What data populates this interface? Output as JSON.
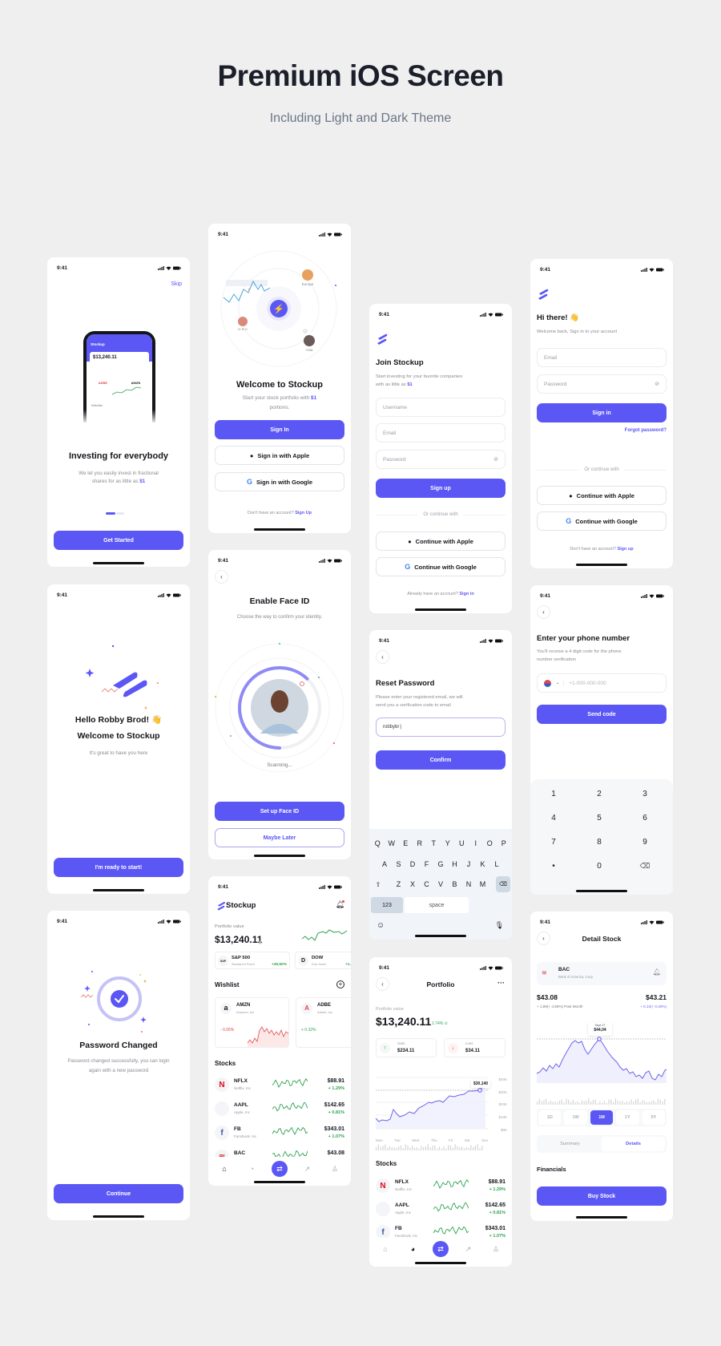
{
  "header": {
    "title": "Premium iOS Screen",
    "subtitle": "Including Light and Dark Theme"
  },
  "status": {
    "time": "9:41"
  },
  "colors": {
    "accent": "#5b57f5",
    "positive": "#2ea24f",
    "negative": "#e24848",
    "background": "#efefef"
  },
  "onboarding": {
    "skip": "Skip",
    "mockup": {
      "app": "Stockup",
      "value": "$13,240.11",
      "ticker1": "ADBE",
      "ticker2": "AMZN",
      "wishlist": "Wishlist"
    },
    "title": "Investing for everybody",
    "subtitle": "We let you easily invest in fractional shares for as little as",
    "highlight": "$1",
    "page_index": 1,
    "page_count": 2,
    "cta": "Get Started"
  },
  "welcome": {
    "avatars": [
      "Europe",
      "U.S.A",
      "Asia"
    ],
    "title": "Welcome to Stockup",
    "subtitle": "Start your stock portfolio with",
    "highlight": "$1",
    "subtitle_end": "portions.",
    "sign_in": "Sign In",
    "apple": "Sign in with Apple",
    "google": "Sign in with Google",
    "footer": "Don't have an account?",
    "footer_link": "Sign Up"
  },
  "join": {
    "title": "Join Stockup",
    "subtitle": "Start investing for your favorite companies with as little as",
    "highlight": "$1",
    "username_placeholder": "Username",
    "email_placeholder": "Email",
    "password_placeholder": "Password",
    "submit": "Sign up",
    "divider": "Or continue with",
    "apple": "Continue with Apple",
    "google": "Continue with Google",
    "footer": "Already have an account?",
    "footer_link": "Sign in"
  },
  "signin": {
    "title": "Hi there! 👋",
    "subtitle": "Welcome back, Sign in to your account",
    "email_placeholder": "Email",
    "password_placeholder": "Password",
    "submit": "Sign in",
    "forgot": "Forgot password?",
    "divider": "Or continue with",
    "apple": "Continue with Apple",
    "google": "Continue with Google",
    "footer": "Don't have an account?",
    "footer_link": "Sign up"
  },
  "hello": {
    "title": "Hello Robby Brod! 👋",
    "title2": "Welcome to Stockup",
    "subtitle": "It's great to have you here",
    "cta": "I'm ready to start!"
  },
  "faceid": {
    "title": "Enable Face ID",
    "subtitle": "Choose the way to confirm your identity.",
    "progress": 0.62,
    "status": "Scanning...",
    "primary": "Set up Face ID",
    "secondary": "Maybe Later"
  },
  "reset": {
    "title": "Reset Password",
    "subtitle": "Please enter your registered email, we will send you a verification code to  email",
    "input_value": "robbybr",
    "submit": "Confirm",
    "keyboard": {
      "row1": [
        "Q",
        "W",
        "E",
        "R",
        "T",
        "Y",
        "U",
        "I",
        "O",
        "P"
      ],
      "row2": [
        "A",
        "S",
        "D",
        "F",
        "G",
        "H",
        "J",
        "K",
        "L"
      ],
      "row3": [
        "Z",
        "X",
        "C",
        "V",
        "B",
        "N",
        "M"
      ],
      "numbers": "123",
      "space": "space"
    }
  },
  "phone": {
    "title": "Enter your phone number",
    "subtitle": "You'll receive a 4 digit code for the phone number verification",
    "placeholder": "+1-000-000-000",
    "submit": "Send code",
    "keypad": [
      "1",
      "2",
      "3",
      "4",
      "5",
      "6",
      "7",
      "8",
      "9",
      "•",
      "0"
    ]
  },
  "home": {
    "app": "Stockup",
    "portfolio_label": "Portfolio value",
    "portfolio_value": "$13,240.11",
    "indices": [
      {
        "logo": "S&P",
        "name": "S&P 500",
        "desc": "Standard & Poor's",
        "change": "+49,50%"
      },
      {
        "logo": "D",
        "name": "DOW",
        "desc": "Dow Jones",
        "change": "+1,"
      }
    ],
    "wishlist_title": "Wishlist",
    "wishlist": [
      {
        "symbol": "AMZN",
        "name": "Amazon, Inc",
        "change": "- 0.05%"
      },
      {
        "symbol": "ADBE",
        "name": "Adobe, Inc",
        "change": "+ 0.32%"
      }
    ],
    "stocks_title": "Stocks",
    "stocks": [
      {
        "symbol": "NFLX",
        "name": "Netflix, Inc",
        "price": "$88.91",
        "change": "+ 1.29%"
      },
      {
        "symbol": "AAPL",
        "name": "Apple, Inc",
        "price": "$142.65",
        "change": "+ 0.81%"
      },
      {
        "symbol": "FB",
        "name": "Facebook, Inc",
        "price": "$343.01",
        "change": "+ 1.07%"
      },
      {
        "symbol": "BAC",
        "name": "",
        "price": "$43.08",
        "change": ""
      }
    ]
  },
  "portfolio": {
    "title": "Portfolio",
    "value_label": "Portfolio value",
    "value": "$13,240.11",
    "change": "1.74%",
    "gain_label": "Gain",
    "gain": "$234.11",
    "loss_label": "Loss",
    "loss": "$34.11",
    "tooltip": "$30,140",
    "y_labels": [
      "$40K",
      "$30K",
      "$20K",
      "$10K",
      "$0K"
    ],
    "days": [
      "Mon",
      "Tue",
      "Wed",
      "Thu",
      "Fri",
      "Sat",
      "Sun"
    ],
    "stocks_title": "Stocks",
    "stocks": [
      {
        "symbol": "NFLX",
        "name": "Netflix, Inc",
        "price": "$88.91",
        "change": "+ 1.29%"
      },
      {
        "symbol": "AAPL",
        "name": "Apple, Inc",
        "price": "$142.65",
        "change": "+ 0.81%"
      },
      {
        "symbol": "FB",
        "name": "Facebook, Inc",
        "price": "$343.01",
        "change": "+ 1.07%"
      }
    ]
  },
  "detail": {
    "title": "Detail Stock",
    "symbol": "BAC",
    "company": "Bank of America, Corp",
    "price_left": "$43.08",
    "change_left": "+ 1,89(+ 4,59%) Past Month",
    "price_right": "$43.21",
    "change_right": "+ 0,13(+ 0,30%)",
    "tooltip_date": "Sept 27",
    "tooltip_value": "$44,04",
    "periods": [
      "1D",
      "1W",
      "1M",
      "1Y",
      "5Y"
    ],
    "active_period": "1M",
    "tabs": [
      "Summary",
      "Details"
    ],
    "active_tab": "Details",
    "section": "Financials",
    "cta": "Buy Stock"
  },
  "password_changed": {
    "title": "Password Changed",
    "subtitle": "Password changed successfully, you can login again with a new password",
    "cta": "Continue"
  }
}
